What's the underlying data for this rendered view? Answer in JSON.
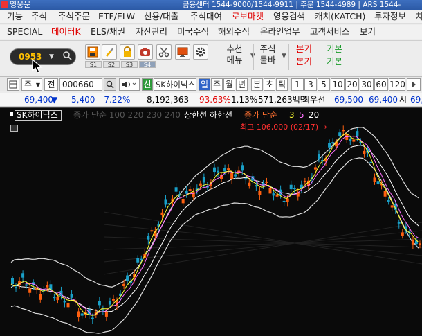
{
  "titlebar": {
    "app_name": "영웅문",
    "info": "금융센터 1544-9000/1544-9911 | 주문 1544-4989 | ARS 1544-"
  },
  "menu_row1": [
    "기능",
    "주식",
    "주식주문",
    "ETF/ELW",
    "신용/대출",
    "주식대여",
    "로보마켓",
    "영웅검색",
    "캐치(KATCH)",
    "투자정보",
    "차"
  ],
  "menu_row2": [
    "SPECIAL",
    "데이터K",
    "ELS/채권",
    "자산관리",
    "미국주식",
    "해외주식",
    "온라인업무",
    "고객서비스",
    "보기"
  ],
  "toolbar": {
    "screen_code": "0953",
    "screen_labels": [
      "S1",
      "S2",
      "S3",
      "S4"
    ],
    "recommend_menu": [
      "추천",
      "메뉴"
    ],
    "stock_toolbar": [
      "주식",
      "툴바"
    ],
    "basic_links": [
      [
        "본기",
        "기본"
      ],
      [
        "본기",
        "기본"
      ]
    ]
  },
  "chart_header": {
    "type_select": "주",
    "prev": "전",
    "stock_code": "000660",
    "credit": "신",
    "stock_name": "SK하이닉스",
    "periods": [
      "일",
      "주",
      "월",
      "년",
      "분",
      "초",
      "틱"
    ],
    "minute_options": [
      "1",
      "3",
      "5",
      "10",
      "20",
      "30",
      "60",
      "120"
    ]
  },
  "quote": {
    "price": "69,400",
    "change_arrow": "▼",
    "change": "5,400",
    "change_pct": "-7.22%",
    "volume": "8,192,363",
    "vol_ratio": "93.63%",
    "turnover_pct": "1.13%",
    "amount": "571,263백만",
    "best_bid_label": "최우선",
    "best_bid1": "69,500",
    "best_bid2": "69,400",
    "open_label": "시",
    "open_value": "69,"
  },
  "chart_legend": {
    "stock_name": "SK하이닉스",
    "faded_text": "종가 단순 100 220 230 240",
    "upper_lower": "상한선 하한선",
    "ma_prefix": "종가 단순",
    "ma_periods": [
      "3",
      "5",
      "20"
    ],
    "high_label": "최고 106,000 (02/17) →"
  },
  "colors": {
    "up_candle": "#ff6010",
    "down_candle": "#19a0c8",
    "ma3": "#ffff30",
    "ma5": "#ff70ff",
    "ma20": "#ffffff",
    "bands": "#ffffff"
  },
  "chart_data": {
    "type": "candlestick",
    "series": [
      {
        "name": "3",
        "type": "line"
      },
      {
        "name": "5",
        "type": "line"
      },
      {
        "name": "20",
        "type": "line"
      }
    ],
    "visible_high": {
      "value": 106000,
      "date": "02/17"
    }
  }
}
